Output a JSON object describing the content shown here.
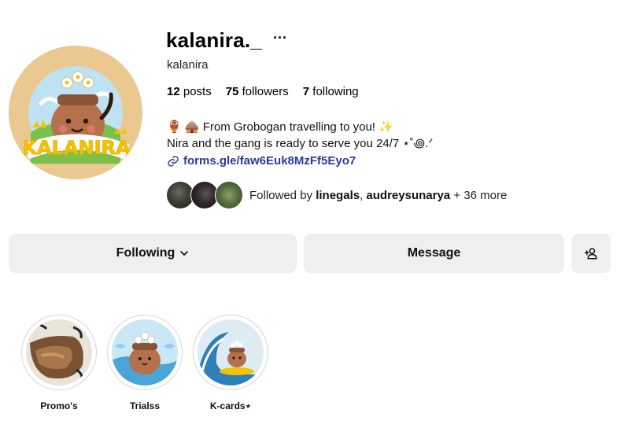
{
  "profile": {
    "username": "kalanira._",
    "more_label": "···",
    "full_name": "kalanira",
    "avatar_text": "KALANIRA"
  },
  "stats": {
    "posts_count": "12",
    "posts_label": "posts",
    "followers_count": "75",
    "followers_label": "followers",
    "following_count": "7",
    "following_label": "following"
  },
  "bio": {
    "line1": "🏺 🛖 From Grobogan travelling to you! ✨",
    "line2": "Nira and the gang is ready to serve you 24/7 ⋆˚꩜.ᐟ",
    "link": "forms.gle/faw6Euk8MzFf5Eyo7"
  },
  "followed_by": {
    "prefix": "Followed by",
    "user1": "linegals",
    "separator": ",",
    "user2": "audreysunarya",
    "suffix": "+ 36 more"
  },
  "actions": {
    "following_label": "Following",
    "message_label": "Message"
  },
  "highlights": [
    {
      "label": "Promo's"
    },
    {
      "label": "Trialss"
    },
    {
      "label": "K-cards⋆"
    }
  ],
  "colors": {
    "avatar_bg": "#ecc891",
    "link": "#2b3a9e",
    "button_bg": "#efeff1"
  }
}
